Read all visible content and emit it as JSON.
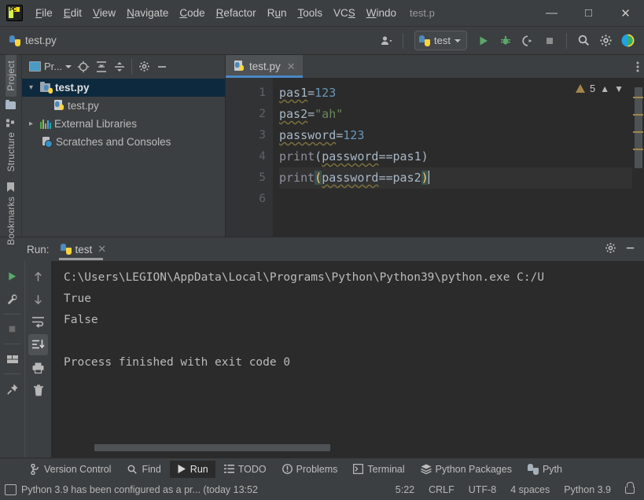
{
  "window": {
    "title": "test.p",
    "minimize": "—",
    "maximize": "□",
    "close": "✕"
  },
  "menubar": {
    "logo_text": "PC",
    "items": [
      {
        "label": "File",
        "mnemonic": "F"
      },
      {
        "label": "Edit",
        "mnemonic": "E"
      },
      {
        "label": "View",
        "mnemonic": "V"
      },
      {
        "label": "Navigate",
        "mnemonic": "N"
      },
      {
        "label": "Code",
        "mnemonic": "C"
      },
      {
        "label": "Refactor",
        "mnemonic": "R"
      },
      {
        "label": "Run",
        "mnemonic": "u"
      },
      {
        "label": "Tools",
        "mnemonic": "T"
      },
      {
        "label": "VCS",
        "mnemonic": "S"
      },
      {
        "label": "Windo",
        "mnemonic": "W"
      }
    ]
  },
  "toolbar": {
    "file_label": "test.py",
    "file_icon": "python-file-icon",
    "user_icon": "user-account-icon",
    "run_config": "test",
    "run_config_icon": "python-icon",
    "run_button_icon": "run-icon",
    "debug_button_icon": "debug-icon",
    "coverage_button_icon": "run-with-coverage-icon",
    "stop_button_icon": "stop-icon",
    "search_icon": "search-icon",
    "settings_icon": "gear-icon",
    "ide_icon": "ide-help-icon"
  },
  "left_strip": {
    "tabs": [
      {
        "label": "Project",
        "active": true
      },
      {
        "label": "Structure",
        "active": false
      },
      {
        "label": "Bookmarks",
        "active": false
      }
    ],
    "folder_icon": "folder-icon",
    "bottom_icon": "layout-icon"
  },
  "project_panel": {
    "title": "Pr...",
    "title_icon": "project-view-icon",
    "toolbar_icons": [
      "locate-icon",
      "expand-all-icon",
      "collapse-all-icon",
      "gear-icon",
      "minimize-icon"
    ],
    "tree": [
      {
        "label": "test.py",
        "icon": "folder-python-icon",
        "indent": 0,
        "expander": "▾",
        "selected": true,
        "bold": true
      },
      {
        "label": "test.py",
        "icon": "python-file-icon",
        "indent": 1,
        "expander": "",
        "selected": false,
        "bold": false
      },
      {
        "label": "External Libraries",
        "icon": "libraries-icon",
        "indent": 0,
        "expander": "▸",
        "selected": false,
        "bold": false
      },
      {
        "label": "Scratches and Consoles",
        "icon": "scratches-icon",
        "indent": 0,
        "expander": "",
        "selected": false,
        "bold": false
      }
    ]
  },
  "editor": {
    "tab": {
      "label": "test.py",
      "icon": "python-file-icon",
      "close": "✕"
    },
    "more_icon": "more-options-icon",
    "line_numbers": [
      "1",
      "2",
      "3",
      "4",
      "5",
      "6"
    ],
    "code_lines": [
      {
        "n": 1,
        "text": "pas1=123"
      },
      {
        "n": 2,
        "text": "pas2=\"ah\""
      },
      {
        "n": 3,
        "text": "password=123"
      },
      {
        "n": 4,
        "text": "print(password==pas1)"
      },
      {
        "n": 5,
        "text": "print(password==pas2)"
      },
      {
        "n": 6,
        "text": ""
      }
    ],
    "warning_count": "5",
    "warning_icon": "warning-triangle-icon",
    "prev_icon": "▲",
    "next_icon": "▼",
    "current_line": 5
  },
  "run_panel": {
    "label": "Run:",
    "tab_label": "test",
    "tab_icon": "python-icon",
    "tab_close": "✕",
    "settings_icon": "gear-icon",
    "minimize_icon": "minimize-icon",
    "left_tools": [
      "rerun-icon",
      "wrench-icon",
      "stop-icon",
      "layout-icon",
      "pin-icon"
    ],
    "right_tools": [
      "scroll-up-icon",
      "scroll-down-icon",
      "soft-wrap-icon",
      "scroll-to-end-icon",
      "print-icon",
      "trash-icon"
    ],
    "console_lines": [
      "C:\\Users\\LEGION\\AppData\\Local\\Programs\\Python\\Python39\\python.exe C:/U",
      "True",
      "False",
      "",
      "Process finished with exit code 0"
    ]
  },
  "bottom_bar": {
    "items": [
      {
        "label": "Version Control",
        "icon": "branch-icon",
        "active": false
      },
      {
        "label": "Find",
        "icon": "search-icon",
        "active": false
      },
      {
        "label": "Run",
        "icon": "run-icon",
        "active": true
      },
      {
        "label": "TODO",
        "icon": "list-icon",
        "active": false
      },
      {
        "label": "Problems",
        "icon": "problems-icon",
        "active": false
      },
      {
        "label": "Terminal",
        "icon": "terminal-icon",
        "active": false
      },
      {
        "label": "Python Packages",
        "icon": "packages-icon",
        "active": false
      },
      {
        "label": "Pyth",
        "icon": "python-icon",
        "active": false
      }
    ]
  },
  "status_bar": {
    "icon": "event-log-icon",
    "message": "Python 3.9 has been configured as a pr... (today 13:52",
    "caret_position": "5:22",
    "line_separator": "CRLF",
    "encoding": "UTF-8",
    "indent": "4 spaces",
    "interpreter": "Python 3.9",
    "lock_icon": "lock-icon"
  },
  "colors": {
    "accent": "#4a88c7",
    "background": "#3c3f41",
    "editor_bg": "#2b2b2b",
    "selection": "#0d293e",
    "number": "#6897bb",
    "string": "#6a8759",
    "warning": "#a2864a",
    "run_green": "#59a869"
  }
}
